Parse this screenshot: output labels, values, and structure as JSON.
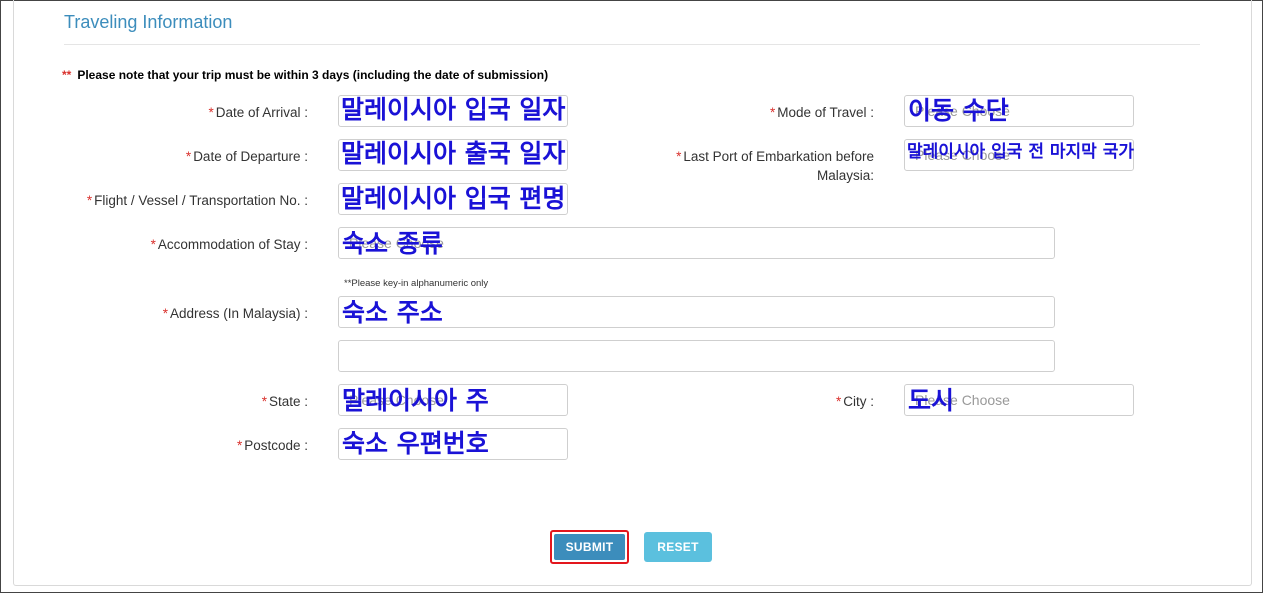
{
  "section": {
    "title": "Traveling Information"
  },
  "notice": {
    "marker": "**",
    "text": "Please note that your trip must be within 3 days (including the date of submission)"
  },
  "required_marker": "*",
  "fields": {
    "arrival": {
      "label": "Date of Arrival :",
      "overlay": "말레이시아 입국 일자"
    },
    "departure": {
      "label": "Date of Departure :",
      "overlay": "말레이시아 출국 일자"
    },
    "flight": {
      "label": "Flight / Vessel / Transportation No. :",
      "overlay": "말레이시아 입국 편명"
    },
    "accommodation": {
      "label": "Accommodation of Stay :",
      "placeholder": "Please Choose",
      "overlay": "숙소 종류"
    },
    "address": {
      "label": "Address (In Malaysia) :",
      "hint": "**Please key-in alphanumeric only",
      "overlay": "숙소 주소",
      "line2": ""
    },
    "state": {
      "label": "State :",
      "placeholder": "Please Choose",
      "overlay": "말레이시아 주"
    },
    "postcode": {
      "label": "Postcode :",
      "overlay": "숙소 우편번호"
    },
    "mode": {
      "label": "Mode of Travel :",
      "placeholder": "Please Choose",
      "overlay": "이동 수단"
    },
    "last_port": {
      "label_line1": "Last Port of Embarkation before",
      "label_line2": "Malaysia:",
      "placeholder": "Please Choose",
      "overlay": "말레이시아 입국 전 마지막 국가"
    },
    "city": {
      "label": "City :",
      "placeholder": "Please Choose",
      "overlay": "도시"
    }
  },
  "buttons": {
    "submit": "SUBMIT",
    "reset": "RESET"
  },
  "colors": {
    "accent": "#3c8dbc",
    "required": "#d9302c",
    "overlay_text": "#1a12d6",
    "submit_highlight": "#e3161d",
    "reset": "#5bc0de"
  }
}
